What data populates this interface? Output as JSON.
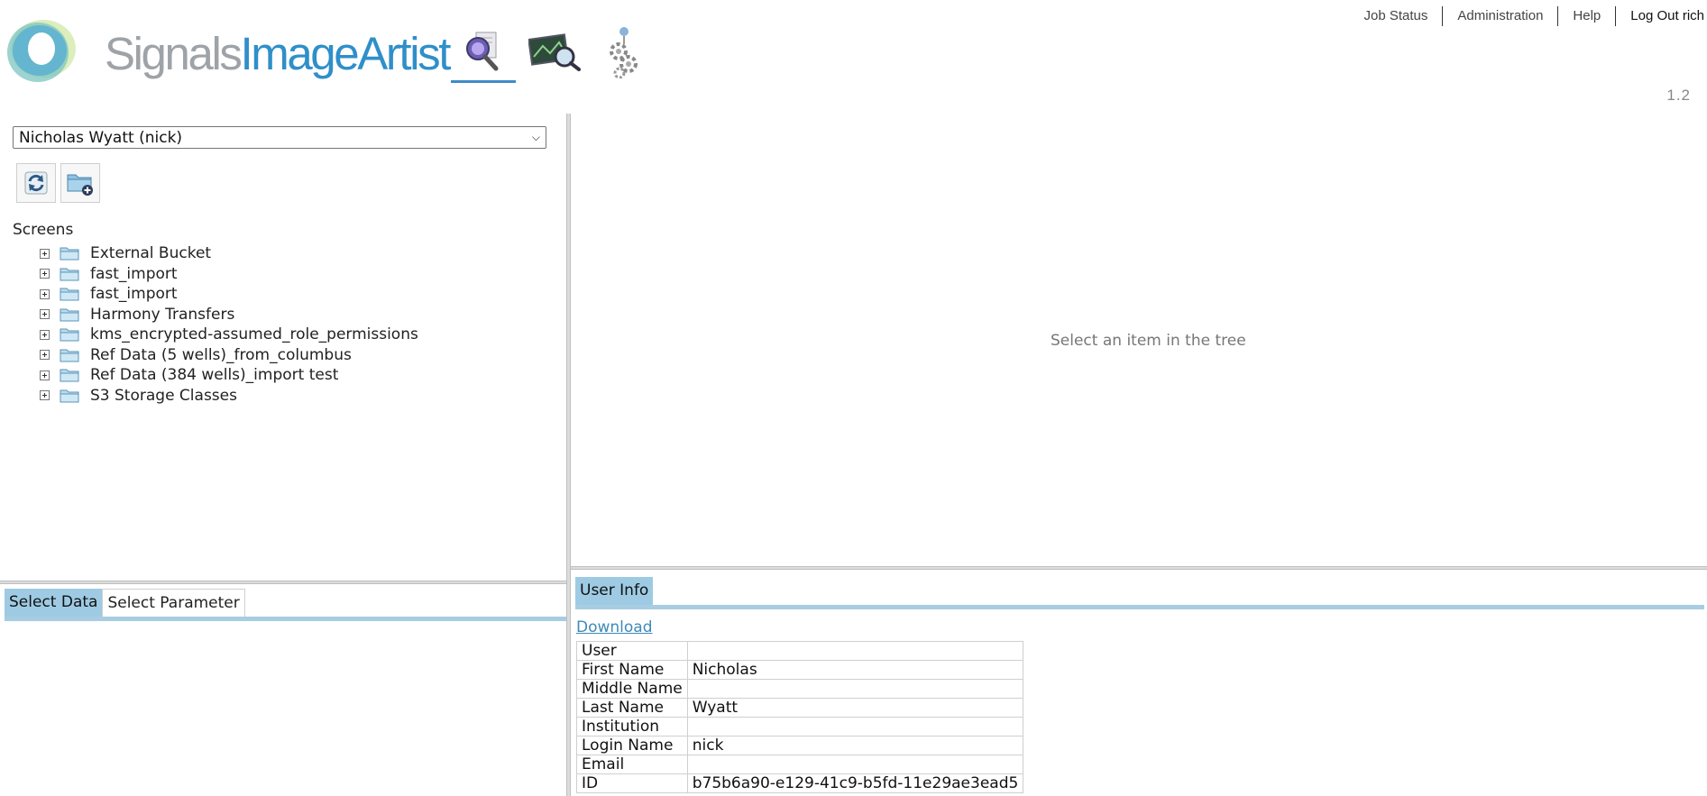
{
  "header": {
    "logo": {
      "word1": "Signals",
      "word2": "ImageArtist"
    },
    "apps": [
      {
        "name": "search-analysis",
        "icon": "magnifier-report-icon",
        "active": true
      },
      {
        "name": "image-viewer",
        "icon": "image-magnifier-icon",
        "active": false
      },
      {
        "name": "settings",
        "icon": "gears-icon",
        "active": false
      }
    ],
    "links": [
      "Job Status",
      "Administration",
      "Help",
      "Log Out rich"
    ],
    "version": "1.2"
  },
  "left": {
    "user_select": "Nicholas Wyatt (nick)",
    "tree_header": "Screens",
    "tree_items": [
      "External Bucket",
      "fast_import",
      "fast_import",
      "Harmony Transfers",
      "kms_encrypted-assumed_role_permissions",
      "Ref Data (5 wells)_from_columbus",
      "Ref Data (384 wells)_import test",
      "S3 Storage Classes"
    ],
    "tabs": [
      "Select Data",
      "Select Parameter"
    ]
  },
  "content": {
    "placeholder": "Select an item in the tree"
  },
  "user_info": {
    "tab": "User Info",
    "download": "Download",
    "rows": [
      {
        "key": "User",
        "value": ""
      },
      {
        "key": "First Name",
        "value": "Nicholas"
      },
      {
        "key": "Middle Name",
        "value": ""
      },
      {
        "key": "Last Name",
        "value": "Wyatt"
      },
      {
        "key": "Institution",
        "value": ""
      },
      {
        "key": "Login Name",
        "value": "nick"
      },
      {
        "key": "Email",
        "value": ""
      },
      {
        "key": "ID",
        "value": "b75b6a90-e129-41c9-b5fd-11e29ae3ead5"
      }
    ]
  },
  "colors": {
    "brand_blue": "#2f8fc9",
    "brand_grey": "#9ea3a8",
    "tab_active": "#9ecbe3",
    "link": "#3e8ab8"
  }
}
